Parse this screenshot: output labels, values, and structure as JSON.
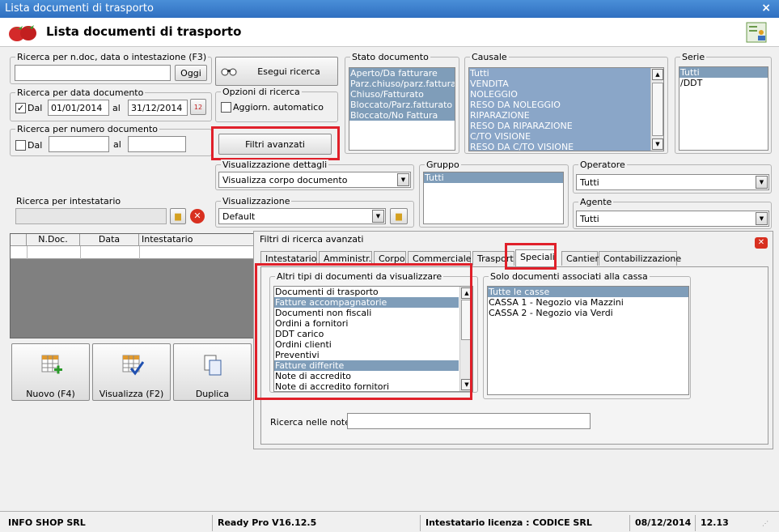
{
  "window": {
    "title": "Lista documenti di trasporto",
    "close": "×"
  },
  "header": {
    "title": "Lista documenti di trasporto"
  },
  "search_doc": {
    "label": "Ricerca per n.doc, data o intestazione (F3)",
    "value": "",
    "button": "Oggi"
  },
  "search_date": {
    "label": "Ricerca per data documento",
    "checked": true,
    "dal_label": "Dal",
    "from": "01/01/2014",
    "al_label": "al",
    "to": "31/12/2014",
    "cal": "12"
  },
  "search_number": {
    "label": "Ricerca per numero documento",
    "checked": false,
    "dal_label": "Dal",
    "al_label": "al",
    "from": "",
    "to": ""
  },
  "run_search": {
    "label": "Esegui ricerca"
  },
  "search_options": {
    "label": "Opzioni di ricerca",
    "auto_label": "Aggiorn. automatico",
    "checked": false
  },
  "advanced_button": {
    "label": "Filtri avanzati"
  },
  "stato": {
    "label": "Stato documento",
    "items": [
      "Aperto/Da fatturare",
      "Parz.chiuso/parz.fatturato",
      "Chiuso/Fatturato",
      "Bloccato/Parz.fatturato",
      "Bloccato/No Fattura"
    ]
  },
  "causale": {
    "label": "Causale",
    "items": [
      "Tutti",
      "VENDITA",
      "NOLEGGIO",
      "RESO DA NOLEGGIO",
      "RIPARAZIONE",
      "RESO DA RIPARAZIONE",
      "C/TO VISIONE",
      "RESO DA C/TO VISIONE"
    ]
  },
  "serie": {
    "label": "Serie",
    "items": [
      "Tutti",
      "/DDT"
    ]
  },
  "view_details": {
    "label": "Visualizzazione dettagli",
    "value": "Visualizza corpo documento"
  },
  "visualizzazione": {
    "label": "Visualizzazione",
    "value": "Default"
  },
  "gruppo": {
    "label": "Gruppo",
    "items": [
      "Tutti"
    ]
  },
  "operatore": {
    "label": "Operatore",
    "value": "Tutti"
  },
  "agente": {
    "label": "Agente",
    "value": "Tutti"
  },
  "intestatario": {
    "label": "Ricerca per intestatario",
    "value": ""
  },
  "grid": {
    "columns": [
      "N.Doc.",
      "Data",
      "Intestatario"
    ]
  },
  "buttons": {
    "new": "Nuovo (F4)",
    "view": "Visualizza (F2)",
    "dup": "Duplica"
  },
  "advanced": {
    "title": "Filtri di ricerca avanzati",
    "tabs": [
      "Intestatario",
      "Amministr.",
      "Corpo",
      "Commerciale",
      "Trasporto",
      "Speciali",
      "Cantieri",
      "Contabilizzazione"
    ],
    "other_types": {
      "label": "Altri tipi di documenti da visualizzare",
      "items": [
        "Documenti di trasporto",
        "Fatture accompagnatorie",
        "Documenti non fiscali",
        "Ordini a fornitori",
        "DDT carico",
        "Ordini clienti",
        "Preventivi",
        "Fatture differite",
        "Note di accredito",
        "Note di accredito fornitori"
      ],
      "selected": [
        1,
        7
      ]
    },
    "cash": {
      "label": "Solo documenti associati alla cassa",
      "items": [
        "Tutte le casse",
        "CASSA 1 - Negozio via Mazzini",
        "CASSA 2 - Negozio via Verdi"
      ]
    },
    "notes": {
      "label": "Ricerca nelle note",
      "value": ""
    }
  },
  "status": {
    "company": "INFO SHOP SRL",
    "version": "Ready Pro V16.12.5",
    "license": "Intestatario licenza : CODICE SRL",
    "date": "08/12/2014",
    "time": "12.13"
  }
}
